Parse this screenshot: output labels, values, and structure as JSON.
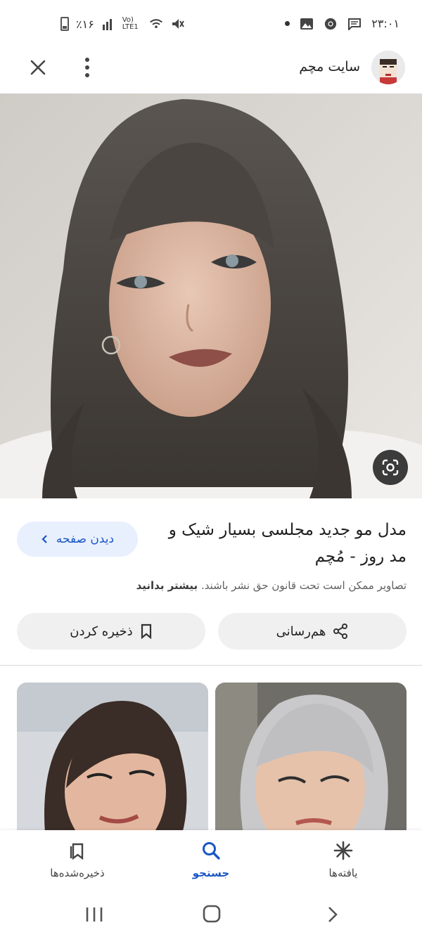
{
  "status_bar": {
    "time": "۲۳:۰۱",
    "battery": "٪۱۶",
    "network": "Vo) LTE1"
  },
  "header": {
    "site_name": "سایت مچم",
    "close_icon": "close-icon",
    "more_icon": "more-vert-icon"
  },
  "result": {
    "title": "مدل مو جدید مجلسی بسیار شیک و مد روز - مُچم",
    "visit_label": "دیدن صفحه",
    "copyright_text": "تصاویر ممکن است تحت قانون حق نشر باشند.",
    "learn_more": "بیشتر بدانید",
    "share_label": "هم‌رسانی",
    "save_label": "ذخیره کردن"
  },
  "bottom_nav": {
    "finds_label": "یافته‌ها",
    "search_label": "جستجو",
    "saved_label": "ذخیره‌شده‌ها"
  },
  "colors": {
    "accent": "#1a56c4",
    "visit_bg": "#e8f0fe",
    "pill_bg": "#f0f0f0"
  }
}
